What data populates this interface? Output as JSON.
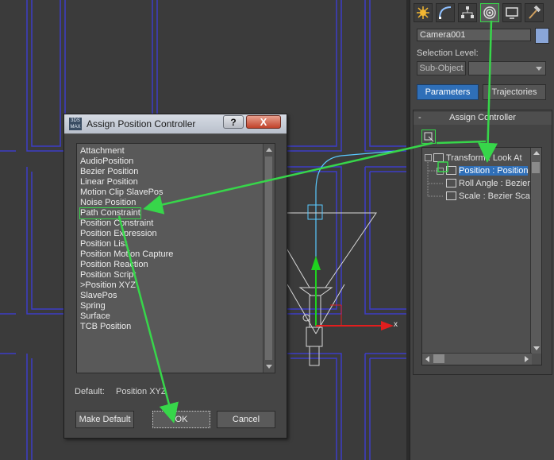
{
  "viewport": {
    "axis_x_label": "x"
  },
  "command_panel": {
    "tabs": [
      {
        "name": "create",
        "icon": "create-star-icon"
      },
      {
        "name": "modify",
        "icon": "modify-curve-icon"
      },
      {
        "name": "hierarchy",
        "icon": "hierarchy-icon"
      },
      {
        "name": "motion",
        "icon": "motion-icon",
        "active": true
      },
      {
        "name": "display",
        "icon": "display-icon"
      },
      {
        "name": "utilities",
        "icon": "utilities-hammer-icon"
      }
    ],
    "object_name": "Camera001",
    "object_color": "#8aa6d8",
    "selection_level_label": "Selection Level:",
    "sub_object_label": "Sub-Object",
    "parameters_label": "Parameters",
    "trajectories_label": "Trajectories",
    "rollout_title": "Assign Controller",
    "rollout_collapse": "-",
    "tree": [
      {
        "label": "Transform : Look At",
        "selected": false
      },
      {
        "label": "Position : Position",
        "selected": true
      },
      {
        "label": "Roll Angle : Bezier",
        "selected": false
      },
      {
        "label": "Scale : Bezier Sca",
        "selected": false
      }
    ]
  },
  "dialog": {
    "title": "Assign Position Controller",
    "help_label": "?",
    "close_label": "X",
    "icon_text": "3DS MAX",
    "items": [
      "Attachment",
      "AudioPosition",
      "Bezier Position",
      "Linear Position",
      "Motion Clip SlavePos",
      "Noise Position",
      "Path Constraint",
      "Position Constraint",
      "Position Expression",
      "Position List",
      "Position Motion Capture",
      "Position Reaction",
      "Position Script",
      ">Position XYZ",
      "SlavePos",
      "Spring",
      "Surface",
      "TCB Position"
    ],
    "highlighted_item": "Path Constraint",
    "default_label": "Default:",
    "default_value": "Position XYZ",
    "make_default_label": "Make Default",
    "ok_label": "OK",
    "cancel_label": "Cancel"
  },
  "annotation_color": "#37d64a"
}
